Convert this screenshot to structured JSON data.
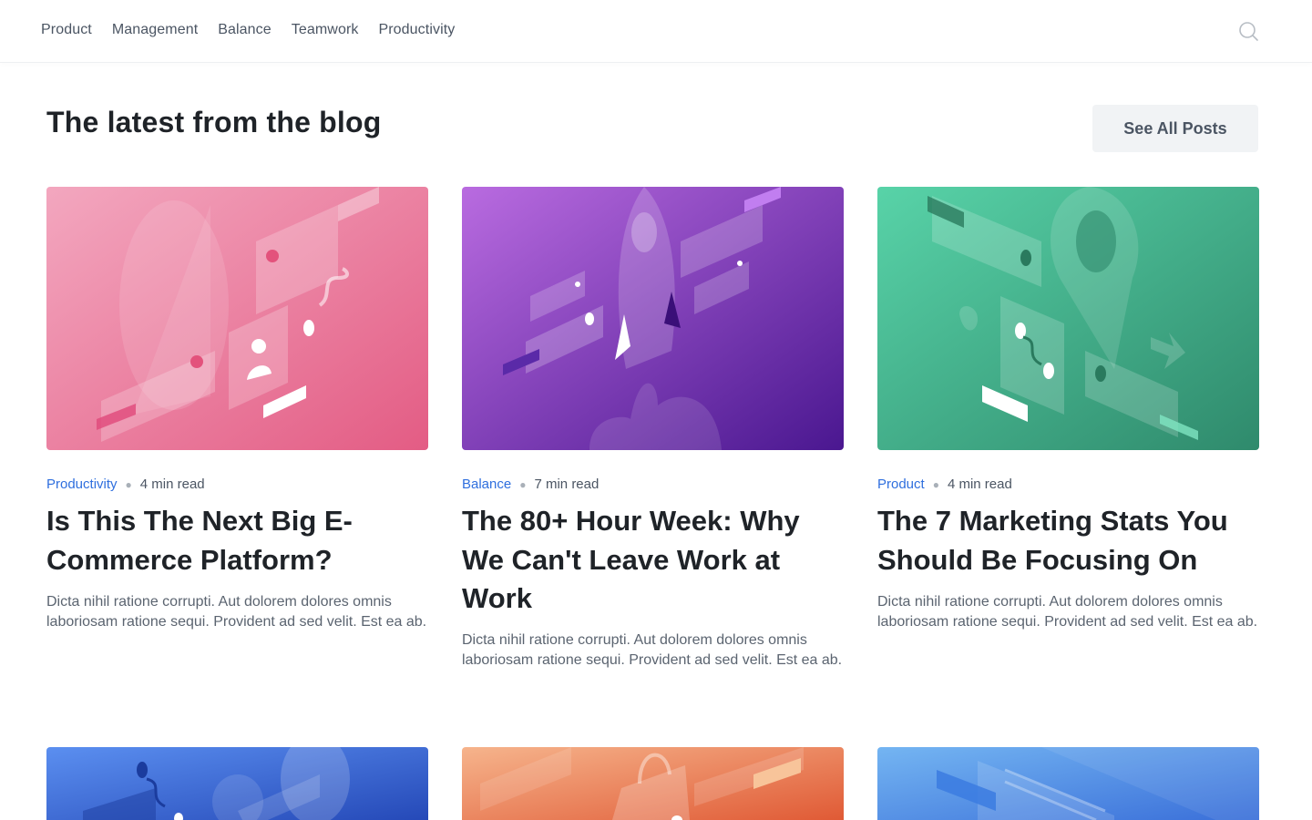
{
  "nav": {
    "links": [
      "Product",
      "Management",
      "Balance",
      "Teamwork",
      "Productivity"
    ],
    "search_icon": "search-icon"
  },
  "blog": {
    "heading": "The latest from the blog",
    "see_all_label": "See All Posts"
  },
  "posts": [
    {
      "category": "Productivity",
      "read_time": "4 min read",
      "title": "Is This The Next Big E-Commerce Platform?",
      "description": "Dicta nihil ratione corrupti. Aut dolorem dolores omnis laboriosam ratione sequi. Provident ad sed velit. Est ea ab.",
      "image_colors": [
        "#f3a7bf",
        "#e35c84"
      ]
    },
    {
      "category": "Balance",
      "read_time": "7 min read",
      "title": "The 80+ Hour Week: Why We Can't Leave Work at Work",
      "description": "Dicta nihil ratione corrupti. Aut dolorem dolores omnis laboriosam ratione sequi. Provident ad sed velit. Est ea ab.",
      "image_colors": [
        "#b96be0",
        "#4a1790"
      ]
    },
    {
      "category": "Product",
      "read_time": "4 min read",
      "title": "The 7 Marketing Stats You Should Be Focusing On",
      "description": "Dicta nihil ratione corrupti. Aut dolorem dolores omnis laboriosam ratione sequi. Provident ad sed velit. Est ea ab.",
      "image_colors": [
        "#58d3a8",
        "#2f8a6c"
      ]
    }
  ],
  "more_posts_colors": [
    [
      "#5b8ff0",
      "#2549b8"
    ],
    [
      "#f6b48c",
      "#e05a35"
    ],
    [
      "#74b5f2",
      "#3a6fd9"
    ]
  ]
}
